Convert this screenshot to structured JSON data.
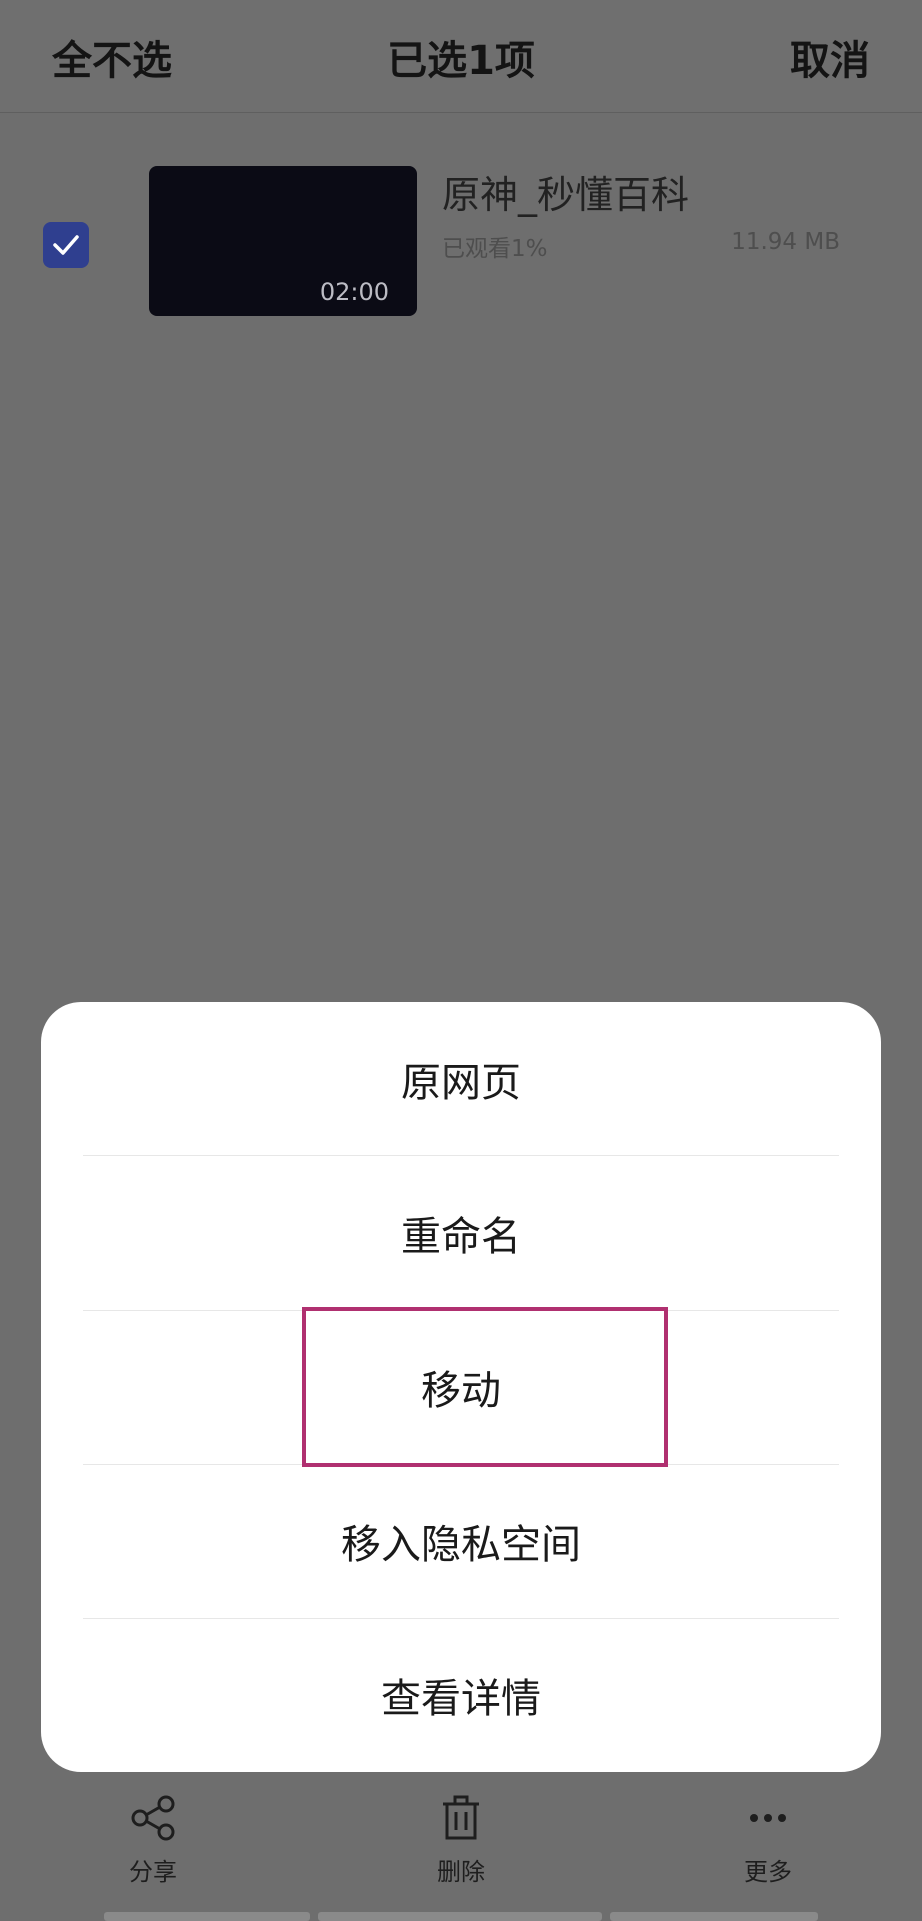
{
  "header": {
    "deselect_all": "全不选",
    "selected_count": "已选1项",
    "cancel": "取消"
  },
  "item": {
    "title": "原神_秒懂百科",
    "watched": "已观看1%",
    "size": "11.94 MB",
    "duration": "02:00",
    "checked": true
  },
  "menu": {
    "items": [
      "原网页",
      "重命名",
      "移动",
      "移入隐私空间",
      "查看详情"
    ]
  },
  "toolbar": {
    "share": "分享",
    "delete": "删除",
    "more": "更多"
  },
  "colors": {
    "overlay": "#6e6e6e",
    "checkbox": "#2f3f8f",
    "highlight": "#b03070",
    "sheet": "#ffffff"
  },
  "icons": {
    "share": "share-icon",
    "delete": "trash-icon",
    "more": "more-dots-icon",
    "check": "check-icon"
  }
}
